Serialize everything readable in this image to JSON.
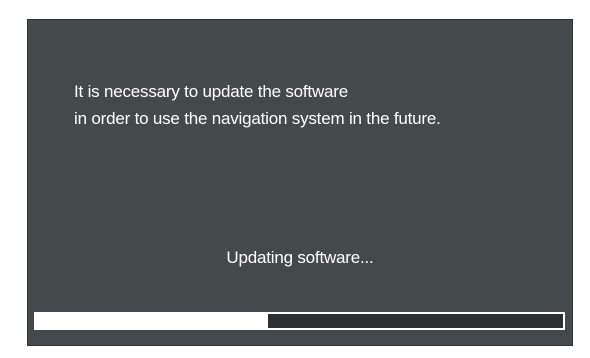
{
  "dialog": {
    "message_line_1": "It is necessary to update the software",
    "message_line_2": "in order to use the navigation system in the future.",
    "status_text": "Updating software..."
  },
  "progress": {
    "fraction": 0.44
  },
  "colors": {
    "screen_background": "#44494c",
    "text": "#ffffff",
    "progress_fill": "#ffffff"
  }
}
